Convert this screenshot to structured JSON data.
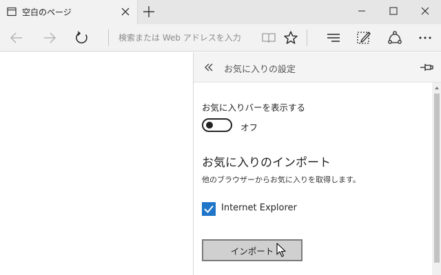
{
  "tab": {
    "title": "空白のページ"
  },
  "toolbar": {
    "address_placeholder": "検索または Web アドレスを入力"
  },
  "panel": {
    "title": "お気に入りの設定",
    "favorites_bar_label": "お気に入りバーを表示する",
    "toggle_state": "オフ",
    "toggle_on": false,
    "import_heading": "お気に入りのインポート",
    "import_description": "他のブラウザーからお気に入りを取得します。",
    "browsers": [
      {
        "label": "Internet Explorer",
        "checked": true
      }
    ],
    "import_button": "インポート"
  },
  "colors": {
    "accent": "#1f76c8",
    "toolbar": "#f2f2f2",
    "titlebar": "#e6e6e6"
  },
  "icons": [
    "page-icon",
    "close-icon",
    "plus-icon",
    "minimize-icon",
    "maximize-icon",
    "close-window-icon",
    "back-arrow-icon",
    "forward-arrow-icon",
    "refresh-icon",
    "reading-view-icon",
    "star-icon",
    "hub-icon",
    "web-note-icon",
    "share-icon",
    "more-icon",
    "double-chevron-left-icon",
    "pin-icon",
    "checkmark-icon",
    "mouse-cursor-icon"
  ]
}
